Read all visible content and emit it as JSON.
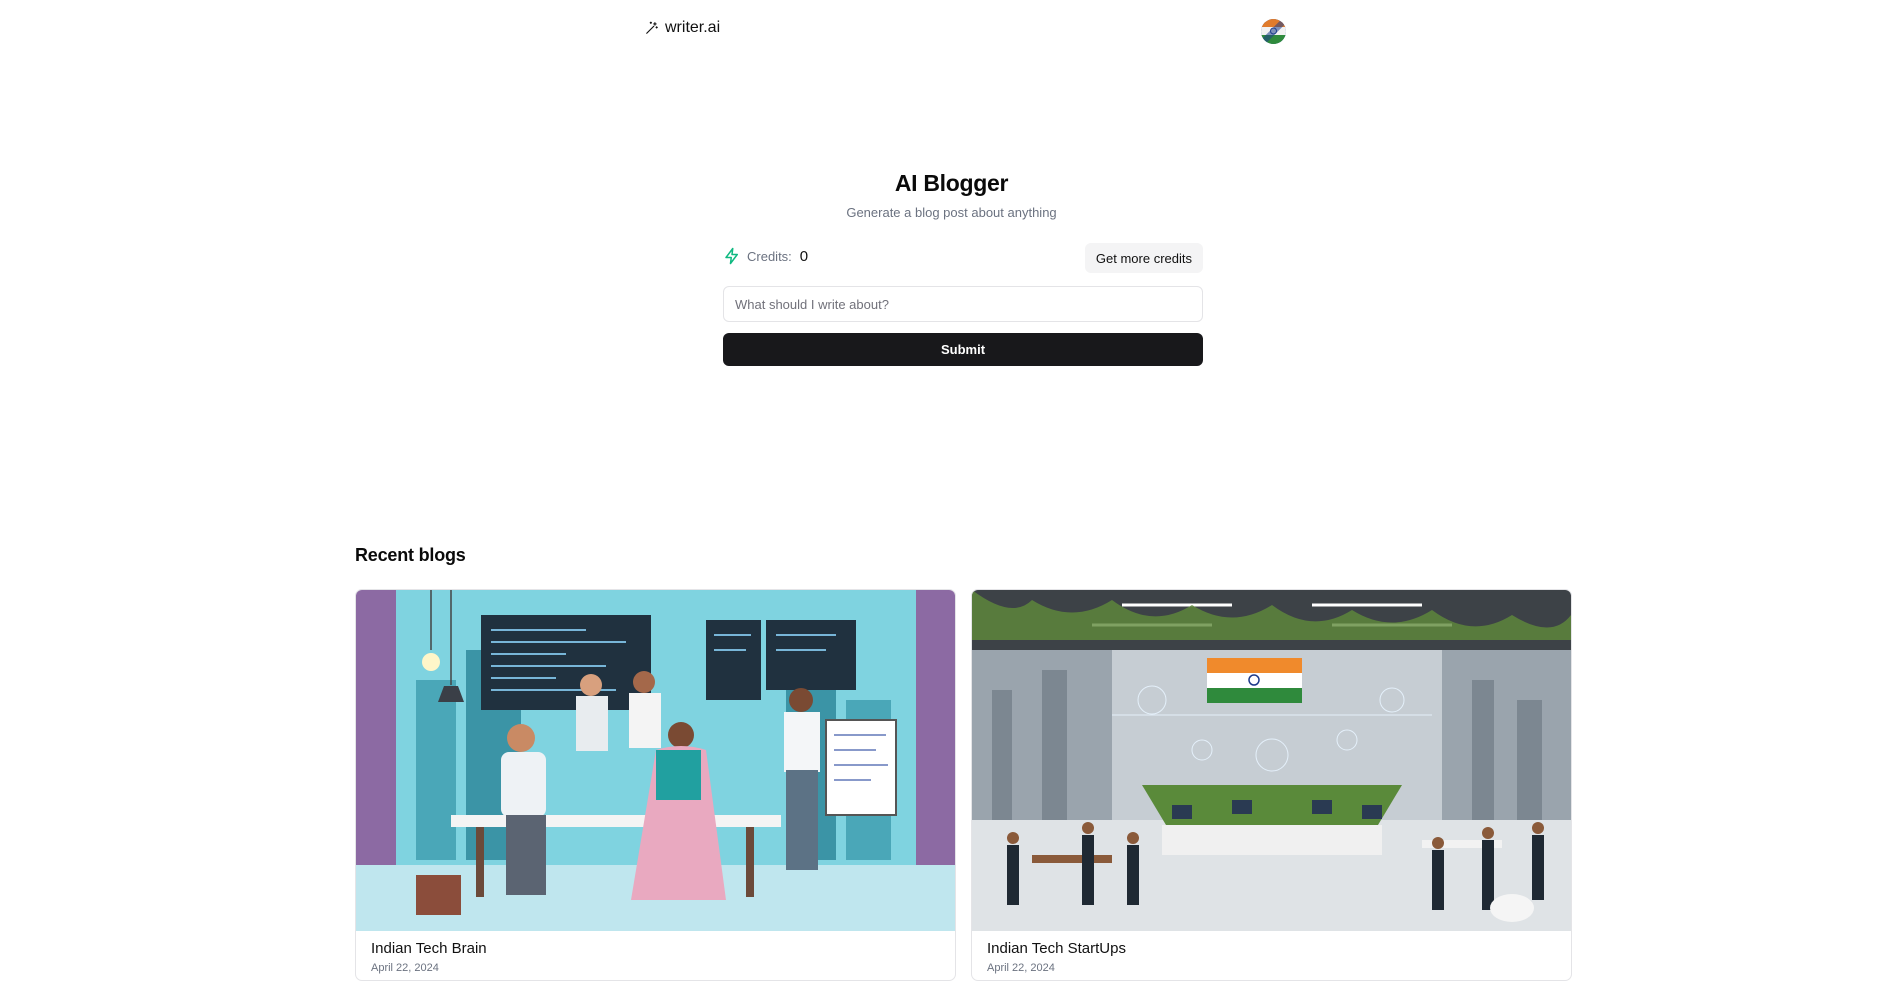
{
  "header": {
    "brand": "writer.ai",
    "brand_icon": "magic-wand-icon"
  },
  "hero": {
    "title": "AI Blogger",
    "subtitle": "Generate a blog post about anything"
  },
  "credits": {
    "icon": "lightning-icon",
    "label": "Credits:",
    "value": "0",
    "accent_color": "#10b981",
    "get_more_label": "Get more credits"
  },
  "form": {
    "placeholder": "What should I write about?",
    "value": "",
    "submit_label": "Submit"
  },
  "recent": {
    "title": "Recent blogs",
    "blogs": [
      {
        "title": "Indian Tech Brain",
        "date": "April 22, 2024"
      },
      {
        "title": "Indian Tech StartUps",
        "date": "April 22, 2024"
      }
    ]
  }
}
